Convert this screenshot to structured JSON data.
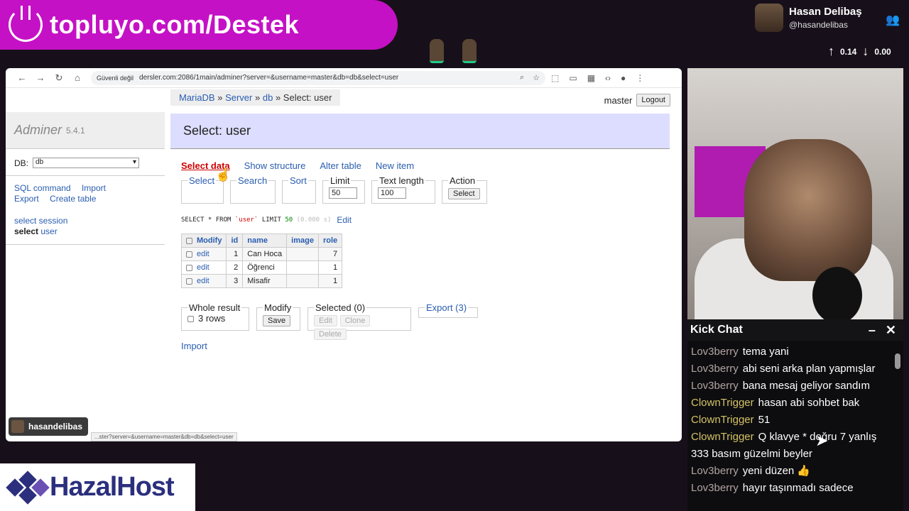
{
  "overlay": {
    "banner_text": "topluyo.com/Destek",
    "profile_name": "Hasan Delibaş",
    "profile_handle": "@hasandelibas",
    "net_up": "0.14",
    "net_down": "0.00",
    "streamer_tag": "hasandelibas",
    "sponsor": "HazalHost"
  },
  "browser": {
    "security_label": "Güvenli değil",
    "url": "dersler.com:2086/1main/adminer?server=&username=master&db=db&select=user",
    "status_url": "...ster?server=&username=master&db=db&select=user"
  },
  "adminer": {
    "breadcrumb": {
      "a": "MariaDB",
      "sep": "»",
      "b": "Server",
      "c": "db",
      "d": "Select: user"
    },
    "user": "master",
    "logout": "Logout",
    "logo": "Adminer",
    "version": "5.4.1",
    "db_label": "DB:",
    "db_value": "db",
    "sql_command": "SQL command",
    "import": "Import",
    "export": "Export",
    "create_table": "Create table",
    "tables": [
      "select session",
      "select"
    ],
    "current_table": "user",
    "page_title": "Select: user",
    "links": [
      "Select data",
      "Show structure",
      "Alter table",
      "New item"
    ],
    "fieldsets": {
      "select": "Select",
      "search": "Search",
      "sort": "Sort",
      "limit": "Limit",
      "limit_value": "50",
      "text_length": "Text length",
      "text_length_value": "100",
      "action": "Action",
      "action_btn": "Select"
    },
    "sql": {
      "query_a": "SELECT * FROM",
      "table": "`user`",
      "limit": "LIMIT",
      "limit_n": "50",
      "time": "(0.000 s)",
      "edit": "Edit"
    },
    "table": {
      "headers": [
        "Modify",
        "id",
        "name",
        "image",
        "role"
      ],
      "rows": [
        {
          "edit": "edit",
          "id": "1",
          "name": "Can Hoca",
          "image": "",
          "role": "7"
        },
        {
          "edit": "edit",
          "id": "2",
          "name": "Öğrenci",
          "image": "",
          "role": "1"
        },
        {
          "edit": "edit",
          "id": "3",
          "name": "Misafir",
          "image": "",
          "role": "1"
        }
      ]
    },
    "bottom": {
      "whole_result": "Whole result",
      "rows": "3 rows",
      "modify": "Modify",
      "save": "Save",
      "selected": "Selected (0)",
      "edit": "Edit",
      "clone": "Clone",
      "delete": "Delete",
      "export": "Export (3)",
      "import": "Import"
    }
  },
  "chat": {
    "title": "Kick Chat",
    "messages": [
      {
        "user": "Lov3berry",
        "color": "#b3a3a3",
        "text": "tema yani"
      },
      {
        "user": "Lov3berry",
        "color": "#b3a3a3",
        "text": "abi seni arka plan yapmışlar"
      },
      {
        "user": "Lov3berry",
        "color": "#b3a3a3",
        "text": "bana mesaj geliyor sandım"
      },
      {
        "user": "ClownTrigger",
        "color": "#d4c266",
        "text": "hasan abi sohbet bak"
      },
      {
        "user": "ClownTrigger",
        "color": "#d4c266",
        "text": "51"
      },
      {
        "user": "ClownTrigger",
        "color": "#d4c266",
        "text": "Q klavye * doğru 7 yanlış 333 basım güzelmi beyler"
      },
      {
        "user": "Lov3berry",
        "color": "#b3a3a3",
        "text": "yeni düzen 👍"
      },
      {
        "user": "Lov3berry",
        "color": "#b3a3a3",
        "text": "hayır taşınmadı sadece"
      }
    ]
  }
}
